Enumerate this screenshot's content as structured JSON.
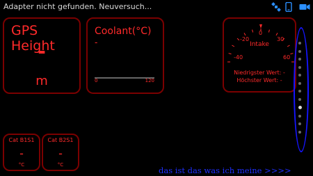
{
  "statusbar": {
    "message": "Adapter nicht gefunden. Neuversuch...",
    "icons": [
      "satellite-icon",
      "phone-icon",
      "camera-icon"
    ]
  },
  "gps_card": {
    "title": "GPS Height",
    "value": "-",
    "unit": "m"
  },
  "coolant_card": {
    "title": "Coolant(°C)",
    "value": "-",
    "min_label": "0",
    "max_label": "120"
  },
  "intake_gauge": {
    "label": "Intake",
    "tick_labels": [
      "-40",
      "-20",
      "0",
      "30",
      "60"
    ],
    "lowest_label": "Niedrigster Wert:",
    "lowest_value": "-",
    "highest_label": "Höchster Wert:",
    "highest_value": "-"
  },
  "cat_b1s1": {
    "title": "Cat B1S1",
    "value": "-",
    "unit": "°C"
  },
  "cat_b2s1": {
    "title": "Cat B2S1",
    "value": "-",
    "unit": "°C"
  },
  "page_indicator": {
    "count": 12,
    "active_index": 8
  },
  "annotation": {
    "text": "das ist das was ich meine >>>>"
  },
  "colors": {
    "accent": "#ff2a2a",
    "card_border": "#7b0000",
    "annotation": "#1515ff"
  }
}
